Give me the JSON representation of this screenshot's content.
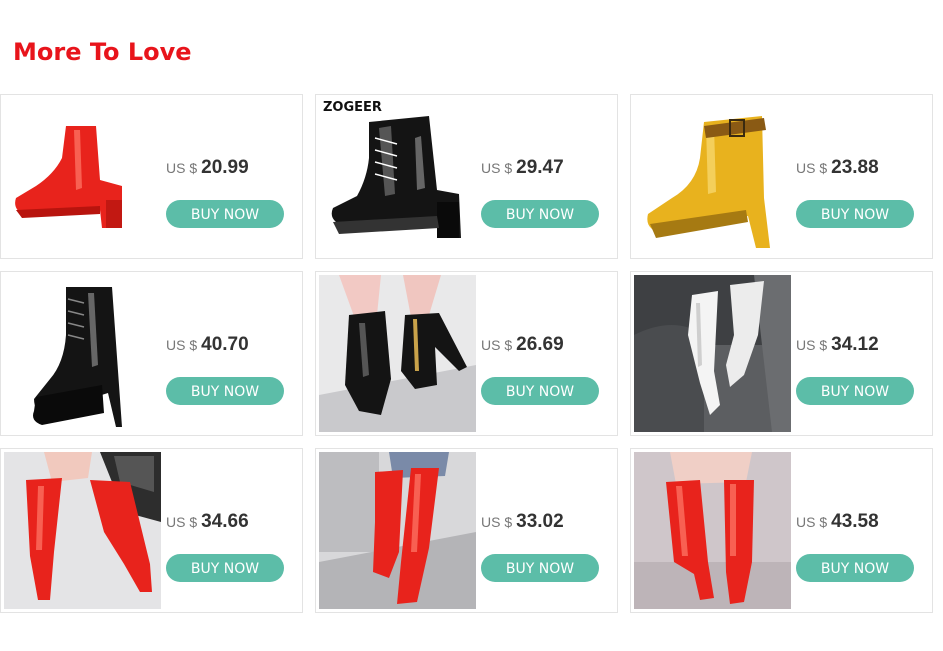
{
  "section": {
    "title": "More To Love"
  },
  "products": [
    {
      "currency": "US $",
      "price": "20.99",
      "buy_label": "BUY NOW",
      "brand": "",
      "image": "red-patent-ankle-boot"
    },
    {
      "currency": "US $",
      "price": "29.47",
      "buy_label": "BUY NOW",
      "brand": "ZOGEER",
      "image": "black-lace-up-ankle-boot"
    },
    {
      "currency": "US $",
      "price": "23.88",
      "buy_label": "BUY NOW",
      "brand": "",
      "image": "yellow-buckle-ankle-boot"
    },
    {
      "currency": "US $",
      "price": "40.70",
      "buy_label": "BUY NOW",
      "brand": "",
      "image": "black-platform-stiletto-boot"
    },
    {
      "currency": "US $",
      "price": "26.69",
      "buy_label": "BUY NOW",
      "brand": "",
      "image": "black-zip-platform-boot-worn"
    },
    {
      "currency": "US $",
      "price": "34.12",
      "buy_label": "BUY NOW",
      "brand": "",
      "image": "white-over-knee-boot"
    },
    {
      "currency": "US $",
      "price": "34.66",
      "buy_label": "BUY NOW",
      "brand": "",
      "image": "red-thigh-high-boot"
    },
    {
      "currency": "US $",
      "price": "33.02",
      "buy_label": "BUY NOW",
      "brand": "",
      "image": "red-thigh-high-boot-street"
    },
    {
      "currency": "US $",
      "price": "43.58",
      "buy_label": "BUY NOW",
      "brand": "",
      "image": "red-knee-high-boot"
    }
  ],
  "colors": {
    "title": "#e8141b",
    "button": "#5cbda8",
    "red_boot": "#e8231c",
    "yellow_boot": "#e8b21e"
  }
}
